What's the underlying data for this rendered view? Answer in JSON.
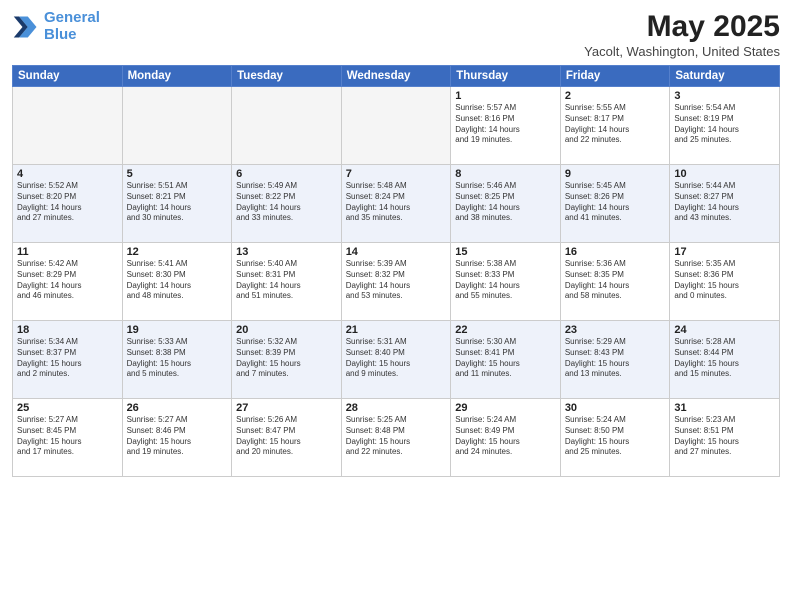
{
  "header": {
    "logo_line1": "General",
    "logo_line2": "Blue",
    "month_title": "May 2025",
    "location": "Yacolt, Washington, United States"
  },
  "weekdays": [
    "Sunday",
    "Monday",
    "Tuesday",
    "Wednesday",
    "Thursday",
    "Friday",
    "Saturday"
  ],
  "weeks": [
    [
      {
        "day": "",
        "detail": ""
      },
      {
        "day": "",
        "detail": ""
      },
      {
        "day": "",
        "detail": ""
      },
      {
        "day": "",
        "detail": ""
      },
      {
        "day": "1",
        "detail": "Sunrise: 5:57 AM\nSunset: 8:16 PM\nDaylight: 14 hours\nand 19 minutes."
      },
      {
        "day": "2",
        "detail": "Sunrise: 5:55 AM\nSunset: 8:17 PM\nDaylight: 14 hours\nand 22 minutes."
      },
      {
        "day": "3",
        "detail": "Sunrise: 5:54 AM\nSunset: 8:19 PM\nDaylight: 14 hours\nand 25 minutes."
      }
    ],
    [
      {
        "day": "4",
        "detail": "Sunrise: 5:52 AM\nSunset: 8:20 PM\nDaylight: 14 hours\nand 27 minutes."
      },
      {
        "day": "5",
        "detail": "Sunrise: 5:51 AM\nSunset: 8:21 PM\nDaylight: 14 hours\nand 30 minutes."
      },
      {
        "day": "6",
        "detail": "Sunrise: 5:49 AM\nSunset: 8:22 PM\nDaylight: 14 hours\nand 33 minutes."
      },
      {
        "day": "7",
        "detail": "Sunrise: 5:48 AM\nSunset: 8:24 PM\nDaylight: 14 hours\nand 35 minutes."
      },
      {
        "day": "8",
        "detail": "Sunrise: 5:46 AM\nSunset: 8:25 PM\nDaylight: 14 hours\nand 38 minutes."
      },
      {
        "day": "9",
        "detail": "Sunrise: 5:45 AM\nSunset: 8:26 PM\nDaylight: 14 hours\nand 41 minutes."
      },
      {
        "day": "10",
        "detail": "Sunrise: 5:44 AM\nSunset: 8:27 PM\nDaylight: 14 hours\nand 43 minutes."
      }
    ],
    [
      {
        "day": "11",
        "detail": "Sunrise: 5:42 AM\nSunset: 8:29 PM\nDaylight: 14 hours\nand 46 minutes."
      },
      {
        "day": "12",
        "detail": "Sunrise: 5:41 AM\nSunset: 8:30 PM\nDaylight: 14 hours\nand 48 minutes."
      },
      {
        "day": "13",
        "detail": "Sunrise: 5:40 AM\nSunset: 8:31 PM\nDaylight: 14 hours\nand 51 minutes."
      },
      {
        "day": "14",
        "detail": "Sunrise: 5:39 AM\nSunset: 8:32 PM\nDaylight: 14 hours\nand 53 minutes."
      },
      {
        "day": "15",
        "detail": "Sunrise: 5:38 AM\nSunset: 8:33 PM\nDaylight: 14 hours\nand 55 minutes."
      },
      {
        "day": "16",
        "detail": "Sunrise: 5:36 AM\nSunset: 8:35 PM\nDaylight: 14 hours\nand 58 minutes."
      },
      {
        "day": "17",
        "detail": "Sunrise: 5:35 AM\nSunset: 8:36 PM\nDaylight: 15 hours\nand 0 minutes."
      }
    ],
    [
      {
        "day": "18",
        "detail": "Sunrise: 5:34 AM\nSunset: 8:37 PM\nDaylight: 15 hours\nand 2 minutes."
      },
      {
        "day": "19",
        "detail": "Sunrise: 5:33 AM\nSunset: 8:38 PM\nDaylight: 15 hours\nand 5 minutes."
      },
      {
        "day": "20",
        "detail": "Sunrise: 5:32 AM\nSunset: 8:39 PM\nDaylight: 15 hours\nand 7 minutes."
      },
      {
        "day": "21",
        "detail": "Sunrise: 5:31 AM\nSunset: 8:40 PM\nDaylight: 15 hours\nand 9 minutes."
      },
      {
        "day": "22",
        "detail": "Sunrise: 5:30 AM\nSunset: 8:41 PM\nDaylight: 15 hours\nand 11 minutes."
      },
      {
        "day": "23",
        "detail": "Sunrise: 5:29 AM\nSunset: 8:43 PM\nDaylight: 15 hours\nand 13 minutes."
      },
      {
        "day": "24",
        "detail": "Sunrise: 5:28 AM\nSunset: 8:44 PM\nDaylight: 15 hours\nand 15 minutes."
      }
    ],
    [
      {
        "day": "25",
        "detail": "Sunrise: 5:27 AM\nSunset: 8:45 PM\nDaylight: 15 hours\nand 17 minutes."
      },
      {
        "day": "26",
        "detail": "Sunrise: 5:27 AM\nSunset: 8:46 PM\nDaylight: 15 hours\nand 19 minutes."
      },
      {
        "day": "27",
        "detail": "Sunrise: 5:26 AM\nSunset: 8:47 PM\nDaylight: 15 hours\nand 20 minutes."
      },
      {
        "day": "28",
        "detail": "Sunrise: 5:25 AM\nSunset: 8:48 PM\nDaylight: 15 hours\nand 22 minutes."
      },
      {
        "day": "29",
        "detail": "Sunrise: 5:24 AM\nSunset: 8:49 PM\nDaylight: 15 hours\nand 24 minutes."
      },
      {
        "day": "30",
        "detail": "Sunrise: 5:24 AM\nSunset: 8:50 PM\nDaylight: 15 hours\nand 25 minutes."
      },
      {
        "day": "31",
        "detail": "Sunrise: 5:23 AM\nSunset: 8:51 PM\nDaylight: 15 hours\nand 27 minutes."
      }
    ]
  ]
}
